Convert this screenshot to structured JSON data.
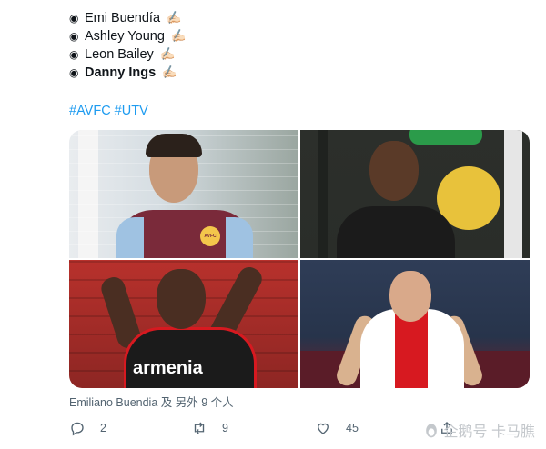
{
  "tweet": {
    "players": [
      {
        "name": "Emi Buendía",
        "emoji": "✍🏻",
        "bold": false
      },
      {
        "name": "Ashley Young",
        "emoji": "✍🏻",
        "bold": false
      },
      {
        "name": "Leon Bailey",
        "emoji": "✍🏻",
        "bold": false
      },
      {
        "name": "Danny Ings",
        "emoji": "✍🏻",
        "bold": true
      }
    ],
    "bullet": "◉",
    "hashtags": [
      "#AVFC",
      "#UTV"
    ],
    "photos": {
      "p1_badge": "AVFC",
      "p3_sponsor": "armenia"
    },
    "tag_caption": "Emiliano Buendia 及 另外 9 个人",
    "actions": {
      "reply_count": "2",
      "retweet_count": "9",
      "like_count": "45"
    }
  },
  "watermark": "企鹅号 卡马膲",
  "colors": {
    "link": "#1d9bf0",
    "muted": "#536471",
    "villa_claret": "#7a2a3a",
    "saints_red": "#d71920"
  },
  "icons": {
    "reply": "reply-icon",
    "retweet": "retweet-icon",
    "like": "heart-icon",
    "share": "share-icon"
  }
}
